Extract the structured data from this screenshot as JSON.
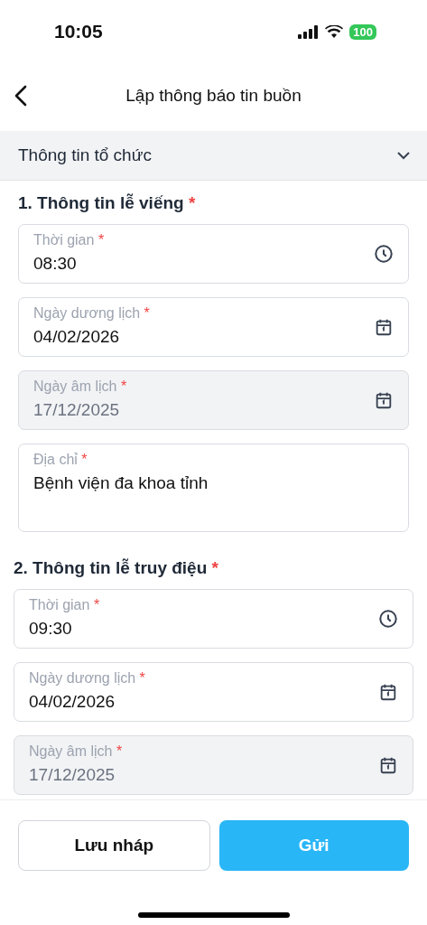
{
  "status_bar": {
    "time": "10:05",
    "battery": "100"
  },
  "header": {
    "title": "Lập thông báo tin buồn"
  },
  "accordion": {
    "title": "Thông tin tổ chức",
    "expanded": true
  },
  "sections": [
    {
      "title": "1. Thông tin lễ viếng",
      "mark": "*",
      "fields": [
        {
          "kind": "time",
          "label": "Thời gian",
          "mark": "*",
          "value": "08:30",
          "disabled": false
        },
        {
          "kind": "date",
          "label": "Ngày dương lịch",
          "mark": "*",
          "value": "04/02/2026",
          "disabled": false
        },
        {
          "kind": "date",
          "label": "Ngày âm lịch",
          "mark": "*",
          "value": "17/12/2025",
          "disabled": true
        },
        {
          "kind": "text",
          "label": "Địa chỉ",
          "mark": "*",
          "value": "Bệnh viện đa khoa tỉnh",
          "disabled": false
        }
      ]
    },
    {
      "title": "2. Thông tin lễ truy điệu",
      "mark": "*",
      "fields": [
        {
          "kind": "time",
          "label": "Thời gian",
          "mark": "*",
          "value": "09:30",
          "disabled": false
        },
        {
          "kind": "date",
          "label": "Ngày dương lịch",
          "mark": "*",
          "value": "04/02/2026",
          "disabled": false
        },
        {
          "kind": "date",
          "label": "Ngày âm lịch",
          "mark": "*",
          "value": "17/12/2025",
          "disabled": true
        }
      ]
    }
  ],
  "buttons": [
    {
      "kind": "secondary",
      "label": "Lưu nháp"
    },
    {
      "kind": "primary",
      "label": "Gửi"
    }
  ]
}
